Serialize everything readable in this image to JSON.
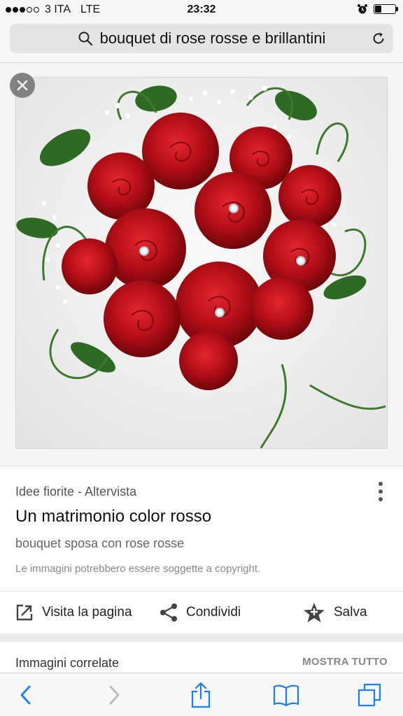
{
  "status_bar": {
    "carrier": "3 ITA",
    "network": "LTE",
    "time": "23:32",
    "signal_bars_filled": 3,
    "signal_bars_total": 5,
    "battery_level": 0.3
  },
  "address_bar": {
    "query": "bouquet di rose rosse e brillantini"
  },
  "result": {
    "source": "Idee fiorite - Altervista",
    "title": "Un matrimonio color rosso",
    "description": "bouquet sposa con rose rosse",
    "copyright_note": "Le immagini potrebbero essere soggette a copyright."
  },
  "actions": {
    "visit": "Visita la pagina",
    "share": "Condividi",
    "save": "Salva"
  },
  "related": {
    "title": "Immagini correlate",
    "show_all": "MOSTRA TUTTO"
  },
  "colors": {
    "accent": "#1a7ef3",
    "rose": "#c8101c"
  }
}
